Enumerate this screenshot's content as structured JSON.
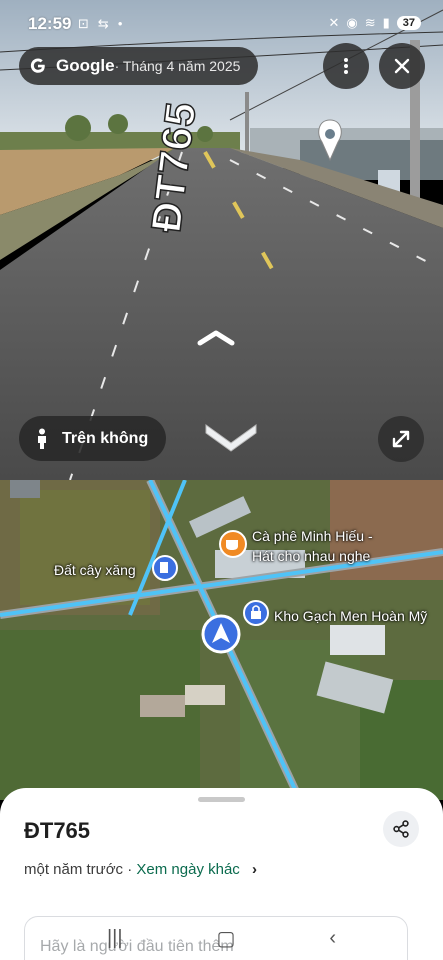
{
  "status_bar": {
    "time": "12:59",
    "battery": "37"
  },
  "street_view": {
    "brand": "Google",
    "date": "· Tháng 4 năm 2025",
    "road_marking": "ĐT765",
    "aerial_label": "Trên không",
    "icons": [
      "google-g-icon",
      "more-vert-icon",
      "close-icon",
      "nav-chevron-up-icon",
      "nav-chevron-down-icon",
      "person-icon",
      "expand-icon",
      "location-pin-icon"
    ]
  },
  "map": {
    "poi_cafe_line1": "Cà phê Minh Hiếu -",
    "poi_cafe_line2": "Hát cho nhau nghe",
    "poi_land": "Đất cây xăng",
    "poi_store": "Kho Gạch Men Hoàn Mỹ",
    "colors": {
      "route": "#4fc3f7",
      "cafe": "#f08a24",
      "poi": "#3b6fe0"
    }
  },
  "sheet": {
    "title": "ĐT765",
    "time_ago": "một năm trước ·",
    "other_dates": "Xem ngày khác",
    "prompt": "Hãy là người đầu tiên thêm"
  }
}
